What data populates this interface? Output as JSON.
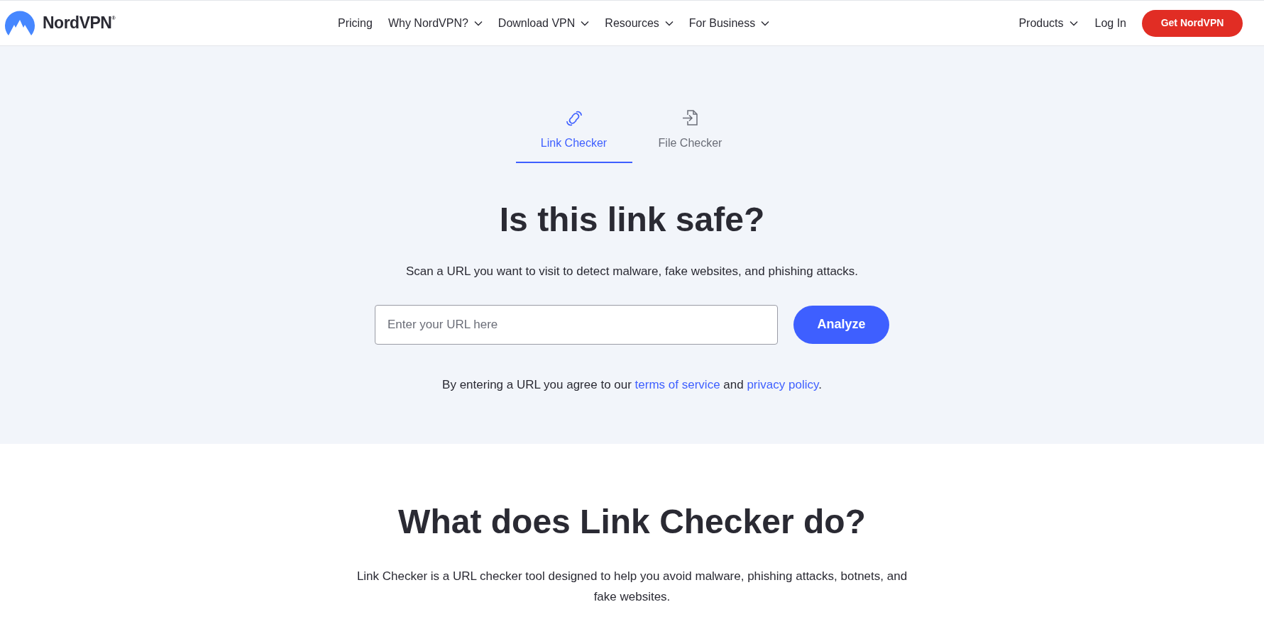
{
  "header": {
    "brand": "NordVPN",
    "brand_mark": "®",
    "nav": [
      {
        "label": "Pricing",
        "dropdown": false
      },
      {
        "label": "Why NordVPN?",
        "dropdown": true
      },
      {
        "label": "Download VPN",
        "dropdown": true
      },
      {
        "label": "Resources",
        "dropdown": true
      },
      {
        "label": "For Business",
        "dropdown": true
      }
    ],
    "right": [
      {
        "label": "Products",
        "dropdown": true
      },
      {
        "label": "Log In",
        "dropdown": false
      }
    ],
    "cta": "Get NordVPN"
  },
  "tabs": [
    {
      "label": "Link Checker",
      "kind": "link",
      "selected": true
    },
    {
      "label": "File Checker",
      "kind": "file",
      "selected": false
    }
  ],
  "hero": {
    "title": "Is this link safe?",
    "subtitle": "Scan a URL you want to visit to detect malware, fake websites, and phishing attacks.",
    "url_field": {
      "placeholder": "Enter your URL here"
    },
    "button": "Analyze",
    "agreement": [
      "By entering a URL you agree to our ",
      "terms of service",
      " and ",
      "privacy policy",
      "."
    ]
  },
  "about": {
    "title": "What does Link Checker do?",
    "text": "Link Checker is a URL checker tool designed to help you avoid malware, phishing attacks, botnets, and fake websites."
  }
}
